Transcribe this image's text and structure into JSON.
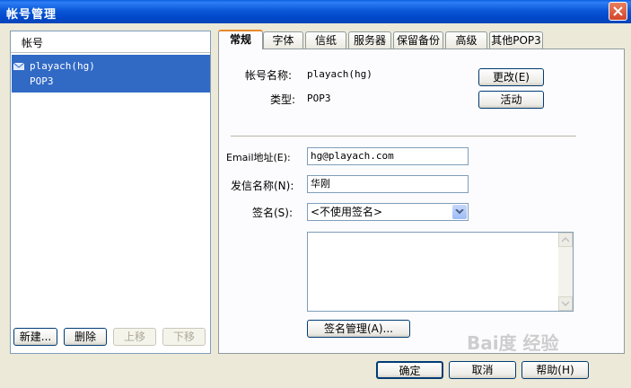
{
  "window": {
    "title": "帐号管理",
    "close_icon": "close-icon"
  },
  "accounts": {
    "header": "帐号",
    "items": [
      {
        "name": "playach(hg)",
        "type": "POP3",
        "icon": "mail-account-icon"
      }
    ],
    "buttons": {
      "new": "新建...",
      "delete": "删除",
      "move_up": "上移",
      "move_down": "下移"
    }
  },
  "tabs": [
    "常规",
    "字体",
    "信纸",
    "服务器",
    "保留备份",
    "高级",
    "其他POP3"
  ],
  "general": {
    "account_name_label": "帐号名称:",
    "account_name_value": "playach(hg)",
    "type_label": "类型:",
    "type_value": "POP3",
    "change_button": "更改(E)",
    "active_button": "活动",
    "email_label": "Email地址(E):",
    "email_value": "hg@playach.com",
    "sender_label": "发信名称(N):",
    "sender_value": "华刚",
    "signature_label": "签名(S):",
    "signature_value": "<不使用签名>",
    "signature_manage_button": "签名管理(A)..."
  },
  "footer": {
    "ok": "确定",
    "cancel": "取消",
    "help": "帮助(H)"
  },
  "watermark": "Bai度 经验",
  "colors": {
    "titlebar": "#0a58d8",
    "selection": "#316ac5",
    "tab_highlight": "#e68b2c"
  }
}
